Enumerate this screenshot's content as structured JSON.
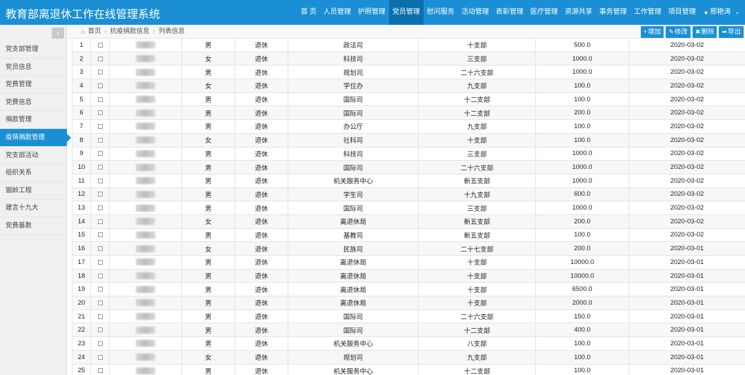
{
  "app": {
    "title": "教育部离退休工作在线管理系统"
  },
  "nav": [
    {
      "label": "首 页"
    },
    {
      "label": "人员管理"
    },
    {
      "label": "护照管理"
    },
    {
      "label": "党员管理",
      "active": true
    },
    {
      "label": "慰问服务"
    },
    {
      "label": "活动管理"
    },
    {
      "label": "表彰管理"
    },
    {
      "label": "医疗管理"
    },
    {
      "label": "资源共享"
    },
    {
      "label": "事务管理"
    },
    {
      "label": "工作管理"
    },
    {
      "label": "项目管理"
    }
  ],
  "user": {
    "name": "邢艳涛",
    "icon": "user-icon"
  },
  "sidebar": {
    "collapse_icon": "‹",
    "items": [
      {
        "label": "党支部管理"
      },
      {
        "label": "党员信息"
      },
      {
        "label": "党费管理"
      },
      {
        "label": "党费信息"
      },
      {
        "label": "捐款管理"
      },
      {
        "label": "疫情捐款管理",
        "active": true
      },
      {
        "label": "党支部活动"
      },
      {
        "label": "组织关系"
      },
      {
        "label": "银龄工程"
      },
      {
        "label": "建言十九大"
      },
      {
        "label": "党费基数"
      }
    ]
  },
  "breadcrumb": {
    "home": "首页",
    "level1": "抗疫捐款信息",
    "level2": "列表信息"
  },
  "toolbar": {
    "add": "增加",
    "edit": "修改",
    "delete": "删除",
    "export": "导出"
  },
  "colors": {
    "brand": "#1a8fd5",
    "active_nav": "#0b6fae"
  },
  "rows": [
    {
      "no": "1",
      "gender": "男",
      "status": "退休",
      "dept": "政法司",
      "branch": "十支部",
      "amount": "500.0",
      "date": "2020-03-02"
    },
    {
      "no": "2",
      "gender": "女",
      "status": "退休",
      "dept": "科技司",
      "branch": "三支部",
      "amount": "1000.0",
      "date": "2020-03-02"
    },
    {
      "no": "3",
      "gender": "男",
      "status": "退休",
      "dept": "规划司",
      "branch": "二十六支部",
      "amount": "1000.0",
      "date": "2020-03-02"
    },
    {
      "no": "4",
      "gender": "女",
      "status": "退休",
      "dept": "学位办",
      "branch": "九支部",
      "amount": "100.0",
      "date": "2020-03-02"
    },
    {
      "no": "5",
      "gender": "男",
      "status": "退休",
      "dept": "国际司",
      "branch": "十二支部",
      "amount": "100.0",
      "date": "2020-03-02"
    },
    {
      "no": "6",
      "gender": "男",
      "status": "退休",
      "dept": "国际司",
      "branch": "十二支部",
      "amount": "200.0",
      "date": "2020-03-02"
    },
    {
      "no": "7",
      "gender": "男",
      "status": "退休",
      "dept": "办公厅",
      "branch": "九支部",
      "amount": "100.0",
      "date": "2020-03-02"
    },
    {
      "no": "8",
      "gender": "女",
      "status": "退休",
      "dept": "社科司",
      "branch": "十支部",
      "amount": "100.0",
      "date": "2020-03-02"
    },
    {
      "no": "9",
      "gender": "男",
      "status": "退休",
      "dept": "科技司",
      "branch": "三支部",
      "amount": "1000.0",
      "date": "2020-03-02"
    },
    {
      "no": "10",
      "gender": "男",
      "status": "退休",
      "dept": "国际司",
      "branch": "二十六支部",
      "amount": "1000.0",
      "date": "2020-03-02"
    },
    {
      "no": "11",
      "gender": "男",
      "status": "退休",
      "dept": "机关服务中心",
      "branch": "新五支部",
      "amount": "1000.0",
      "date": "2020-03-02"
    },
    {
      "no": "12",
      "gender": "男",
      "status": "退休",
      "dept": "学生司",
      "branch": "十九支部",
      "amount": "600.0",
      "date": "2020-03-02"
    },
    {
      "no": "13",
      "gender": "男",
      "status": "退休",
      "dept": "国际司",
      "branch": "三支部",
      "amount": "1000.0",
      "date": "2020-03-02"
    },
    {
      "no": "14",
      "gender": "女",
      "status": "退休",
      "dept": "离退休局",
      "branch": "新五支部",
      "amount": "200.0",
      "date": "2020-03-02"
    },
    {
      "no": "15",
      "gender": "男",
      "status": "退休",
      "dept": "基教司",
      "branch": "新五支部",
      "amount": "100.0",
      "date": "2020-03-02"
    },
    {
      "no": "16",
      "gender": "女",
      "status": "退休",
      "dept": "民族司",
      "branch": "二十七支部",
      "amount": "200.0",
      "date": "2020-03-01"
    },
    {
      "no": "17",
      "gender": "男",
      "status": "退休",
      "dept": "离退休局",
      "branch": "十支部",
      "amount": "10000.0",
      "date": "2020-03-01"
    },
    {
      "no": "18",
      "gender": "男",
      "status": "退休",
      "dept": "离退休局",
      "branch": "十支部",
      "amount": "10000.0",
      "date": "2020-03-01"
    },
    {
      "no": "19",
      "gender": "男",
      "status": "退休",
      "dept": "离退休局",
      "branch": "十支部",
      "amount": "6500.0",
      "date": "2020-03-01"
    },
    {
      "no": "20",
      "gender": "男",
      "status": "退休",
      "dept": "离退休局",
      "branch": "十支部",
      "amount": "2000.0",
      "date": "2020-03-01"
    },
    {
      "no": "21",
      "gender": "男",
      "status": "退休",
      "dept": "国际司",
      "branch": "二十六支部",
      "amount": "150.0",
      "date": "2020-03-01"
    },
    {
      "no": "22",
      "gender": "男",
      "status": "退休",
      "dept": "国际司",
      "branch": "十二支部",
      "amount": "400.0",
      "date": "2020-03-01"
    },
    {
      "no": "23",
      "gender": "男",
      "status": "退休",
      "dept": "机关服务中心",
      "branch": "八支部",
      "amount": "100.0",
      "date": "2020-03-01"
    },
    {
      "no": "24",
      "gender": "女",
      "status": "退休",
      "dept": "规划司",
      "branch": "九支部",
      "amount": "100.0",
      "date": "2020-03-01"
    },
    {
      "no": "25",
      "gender": "男",
      "status": "退休",
      "dept": "机关服务中心",
      "branch": "十二支部",
      "amount": "100.0",
      "date": "2020-03-01"
    }
  ]
}
